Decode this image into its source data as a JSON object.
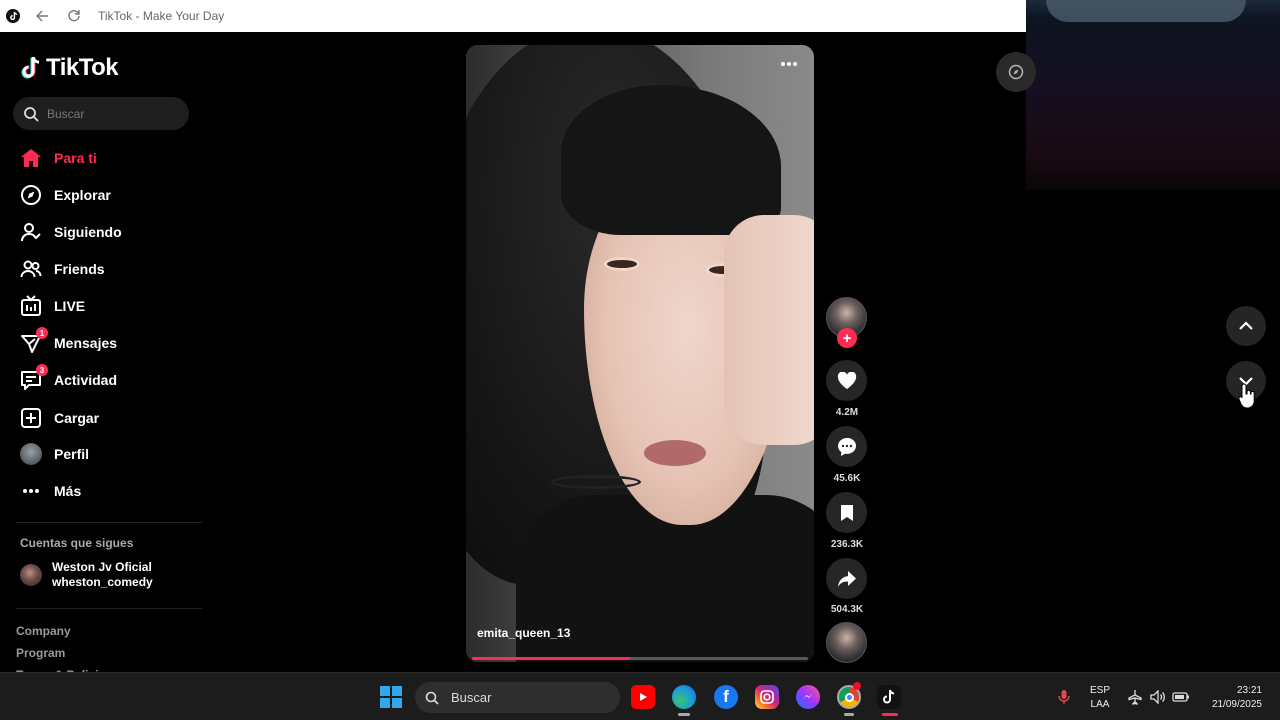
{
  "browser": {
    "title": "TikTok - Make Your Day"
  },
  "sidebar": {
    "logo_text": "TikTok",
    "search_placeholder": "Buscar",
    "nav": [
      {
        "label": "Para ti",
        "icon": "home-icon",
        "active": true
      },
      {
        "label": "Explorar",
        "icon": "compass-icon"
      },
      {
        "label": "Siguiendo",
        "icon": "following-icon"
      },
      {
        "label": "Friends",
        "icon": "friends-icon"
      },
      {
        "label": "LIVE",
        "icon": "live-icon"
      },
      {
        "label": "Mensajes",
        "icon": "messages-icon",
        "badge": "1"
      },
      {
        "label": "Actividad",
        "icon": "activity-icon",
        "badge": "3"
      },
      {
        "label": "Cargar",
        "icon": "upload-icon"
      },
      {
        "label": "Perfil",
        "icon": "profile-avatar"
      },
      {
        "label": "Más",
        "icon": "more-icon"
      }
    ],
    "following_title": "Cuentas que sigues",
    "following": [
      {
        "name": "Weston Jv Oficial",
        "handle": "wheston_comedy"
      }
    ],
    "footer_links": [
      "Company",
      "Program",
      "Terms & Policies"
    ]
  },
  "video": {
    "username": "emita_queen_13",
    "progress": 0.47
  },
  "actions": {
    "likes": "4.2M",
    "comments": "45.6K",
    "saves": "236.3K",
    "shares": "504.3K"
  },
  "taskbar": {
    "search_label": "Buscar",
    "lang_line1": "ESP",
    "lang_line2": "LAA",
    "time": "23:21",
    "date": "21/09/2025",
    "apps": [
      "windows-start-icon",
      "youtube-icon",
      "edge-icon",
      "facebook-icon",
      "instagram-icon",
      "messenger-icon",
      "chrome-icon",
      "tiktok-icon"
    ]
  },
  "colors": {
    "accent": "#fe2c55",
    "background": "#000000"
  }
}
